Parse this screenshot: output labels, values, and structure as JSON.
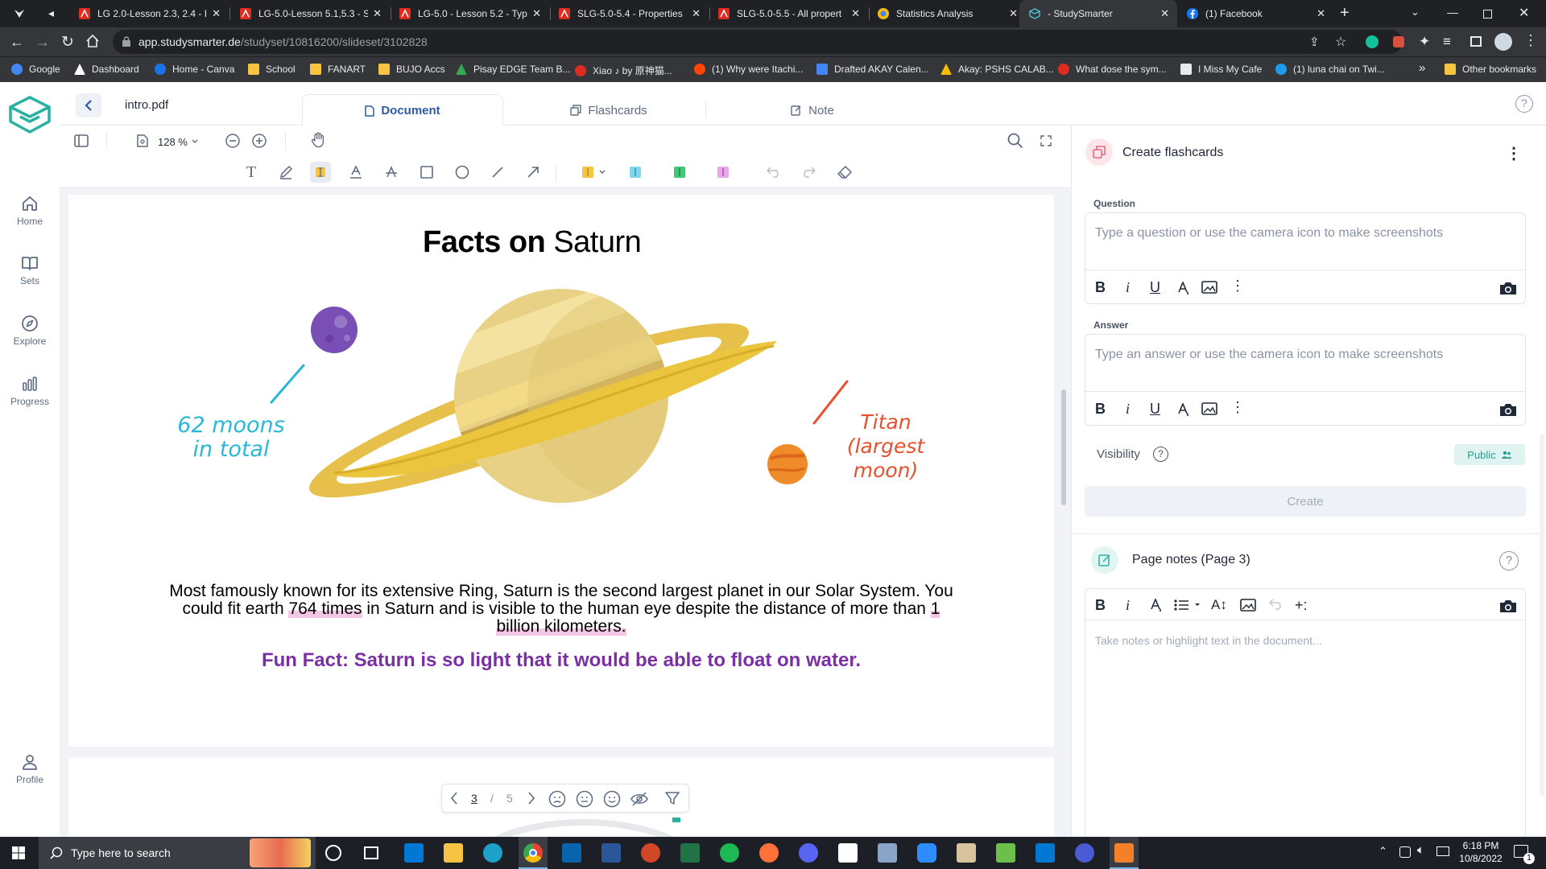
{
  "browser": {
    "tabs": [
      {
        "title": "LG 2.0-Lesson 2.3, 2.4 - I",
        "icon": "pdf-icon"
      },
      {
        "title": "LG-5.0-Lesson 5.1,5.3 - S",
        "icon": "pdf-icon"
      },
      {
        "title": "LG-5.0 - Lesson 5.2 - Typ",
        "icon": "pdf-icon"
      },
      {
        "title": "SLG-5.0-5.4 - Properties",
        "icon": "pdf-icon"
      },
      {
        "title": "SLG-5.0-5.5 - All propert",
        "icon": "pdf-icon"
      },
      {
        "title": "Statistics Analysis",
        "icon": "google-icon"
      },
      {
        "title": "- StudySmarter",
        "icon": "studysmarter-icon"
      },
      {
        "title": "(1) Facebook",
        "icon": "facebook-icon"
      }
    ],
    "url_domain": "app.studysmarter.de",
    "url_path": "/studyset/10816200/slideset/3102828",
    "bookmarks": [
      "Google",
      "Dashboard",
      "Home - Canva",
      "School",
      "FANART",
      "BUJO Accs",
      "Pisay EDGE Team B...",
      "Xiao ♪ by 原神猫...",
      "(1) Why were Itachi...",
      "Drafted AKAY Calen...",
      "Akay: PSHS CALAB...",
      "What dose the sym...",
      "I Miss My Cafe",
      "(1) luna chai on Twi..."
    ],
    "more_bookmarks": "»",
    "other_bookmarks": "Other bookmarks"
  },
  "sidebar": {
    "items": [
      {
        "label": "Home",
        "icon": "home-icon"
      },
      {
        "label": "Sets",
        "icon": "book-icon"
      },
      {
        "label": "Explore",
        "icon": "compass-icon"
      },
      {
        "label": "Progress",
        "icon": "bar-chart-icon"
      }
    ],
    "profile": "Profile"
  },
  "header": {
    "filename": "intro.pdf",
    "tabs": [
      {
        "label": "Document",
        "active": true
      },
      {
        "label": "Flashcards",
        "active": false
      },
      {
        "label": "Note",
        "active": false
      }
    ]
  },
  "doc_toolbar": {
    "zoom": "128 %"
  },
  "document": {
    "title_bold": "Facts on",
    "title_regular": "Saturn",
    "moons_note_line1": "62 moons",
    "moons_note_line2": "in total",
    "titan_line1": "Titan",
    "titan_line2": "(largest",
    "titan_line3": "moon)",
    "para_line1": "Most famously known for its extensive Ring, Saturn is the second largest planet in our Solar System. You",
    "para_line2_a": "could fit earth ",
    "para_line2_b": "764 times",
    "para_line2_c": " in Saturn and is visible to the human eye despite the distance of  more than ",
    "para_line2_d": "1",
    "para_line3": "billion kilometers.",
    "fun_fact": "Fun Fact: Saturn is so light that it would be able to float on water.",
    "colors": {
      "moons_note": "#2bb8d8",
      "titan_note": "#e8502d",
      "fun_fact": "#7b2fa5",
      "highlight": "#f4c6e6"
    }
  },
  "pager": {
    "current": "3",
    "sep": "/",
    "total": "5"
  },
  "flashcard_panel": {
    "title": "Create flashcards",
    "question_label": "Question",
    "question_placeholder": "Type a question or use the camera icon to make screenshots",
    "answer_label": "Answer",
    "answer_placeholder": "Type an answer or use the camera icon to make screenshots",
    "visibility_label": "Visibility",
    "visibility_value": "Public",
    "create_button": "Create",
    "bold": "B",
    "italic": "i",
    "underline": "U"
  },
  "notes_panel": {
    "title": "Page notes (Page 3)",
    "placeholder": "Take notes or highlight text in the document..."
  },
  "taskbar": {
    "search_placeholder": "Type here to search",
    "time": "6:18 PM",
    "date": "10/8/2022",
    "notification_count": "1"
  },
  "accent": "#2ab1a3"
}
